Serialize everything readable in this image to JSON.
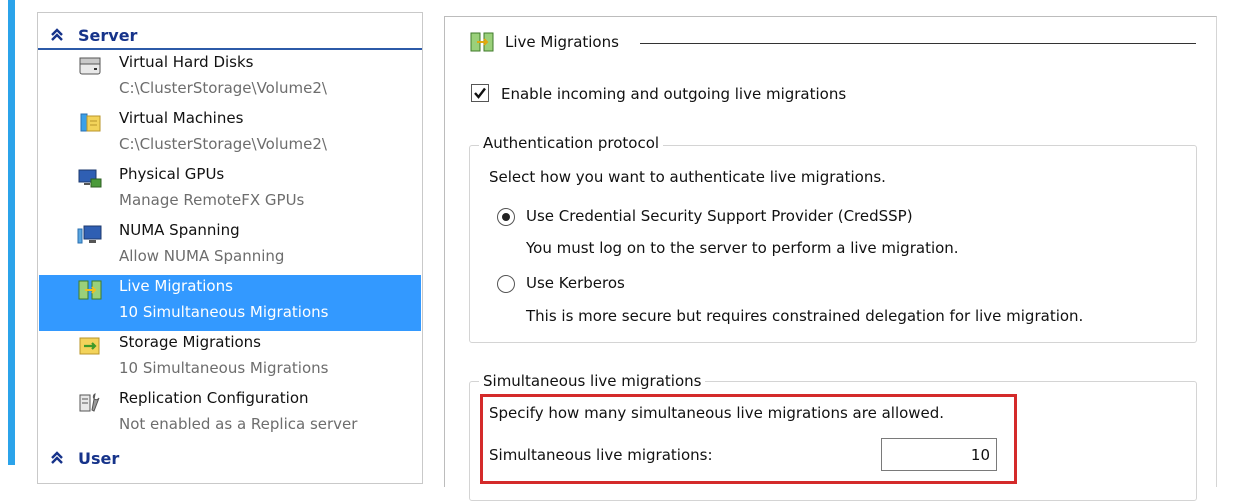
{
  "nav": {
    "server_header": "Server",
    "user_header": "User",
    "items": [
      {
        "title": "Virtual Hard Disks",
        "subtitle": "C:\\ClusterStorage\\Volume2\\",
        "icon": "hard-disk-icon",
        "selected": false
      },
      {
        "title": "Virtual Machines",
        "subtitle": "C:\\ClusterStorage\\Volume2\\",
        "icon": "folder-files-icon",
        "selected": false
      },
      {
        "title": "Physical GPUs",
        "subtitle": "Manage RemoteFX GPUs",
        "icon": "monitor-gpu-icon",
        "selected": false
      },
      {
        "title": "NUMA Spanning",
        "subtitle": "Allow NUMA Spanning",
        "icon": "numa-monitor-icon",
        "selected": false
      },
      {
        "title": "Live Migrations",
        "subtitle": "10 Simultaneous Migrations",
        "icon": "live-migration-icon",
        "selected": true
      },
      {
        "title": "Storage Migrations",
        "subtitle": "10 Simultaneous Migrations",
        "icon": "storage-migration-icon",
        "selected": false
      },
      {
        "title": "Replication Configuration",
        "subtitle": "Not enabled as a Replica server",
        "icon": "replication-config-icon",
        "selected": false
      }
    ]
  },
  "main": {
    "title": "Live Migrations",
    "enable_checkbox": {
      "label": "Enable incoming and outgoing live migrations",
      "checked": true
    },
    "auth": {
      "legend": "Authentication protocol",
      "instruction": "Select how you want to authenticate live migrations.",
      "options": [
        {
          "label": "Use Credential Security Support Provider (CredSSP)",
          "description": "You must log on to the server to perform a live migration.",
          "selected": true
        },
        {
          "label": "Use Kerberos",
          "description": "This is more secure but requires constrained delegation for live migration.",
          "selected": false
        }
      ]
    },
    "simultaneous": {
      "legend": "Simultaneous live migrations",
      "instruction": "Specify how many simultaneous live migrations are allowed.",
      "field_label": "Simultaneous live migrations:",
      "value": "10"
    }
  },
  "colors": {
    "accent": "#2ba3ea",
    "selection": "#3399ff",
    "header_text": "#16338a",
    "highlight": "#d42a2a"
  }
}
